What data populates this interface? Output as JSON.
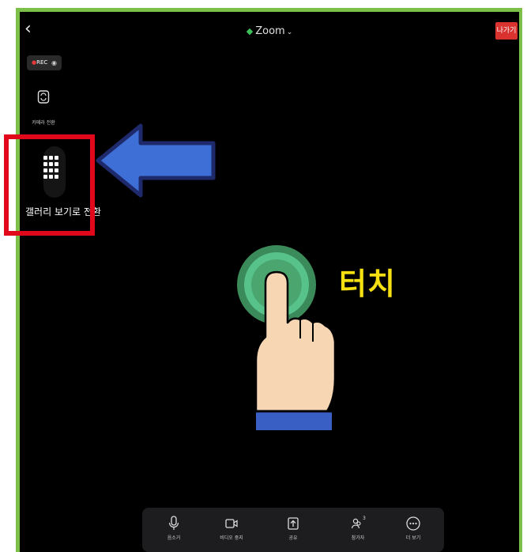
{
  "header": {
    "back_icon": "chevron-left-icon",
    "title": "Zoom",
    "leave_label": "나가기",
    "colors": {
      "leave": "#d9322f",
      "shield": "#3fbf5a"
    }
  },
  "recording": {
    "label": "REC"
  },
  "side": {
    "camera_switch_label": "카메라 전환",
    "gallery_label": "갤러리 보기로 전환"
  },
  "overlay": {
    "touch_label": "터치",
    "arrow_color": "#3d6fd6",
    "highlight_color": "#e0081a"
  },
  "toolbar": {
    "items": [
      {
        "label": "음소거",
        "icon": "microphone-icon"
      },
      {
        "label": "비디오 중지",
        "icon": "video-camera-icon"
      },
      {
        "label": "공유",
        "icon": "share-icon"
      },
      {
        "label": "참가자",
        "icon": "participants-icon",
        "count": "3"
      },
      {
        "label": "더 보기",
        "icon": "more-icon"
      }
    ]
  }
}
